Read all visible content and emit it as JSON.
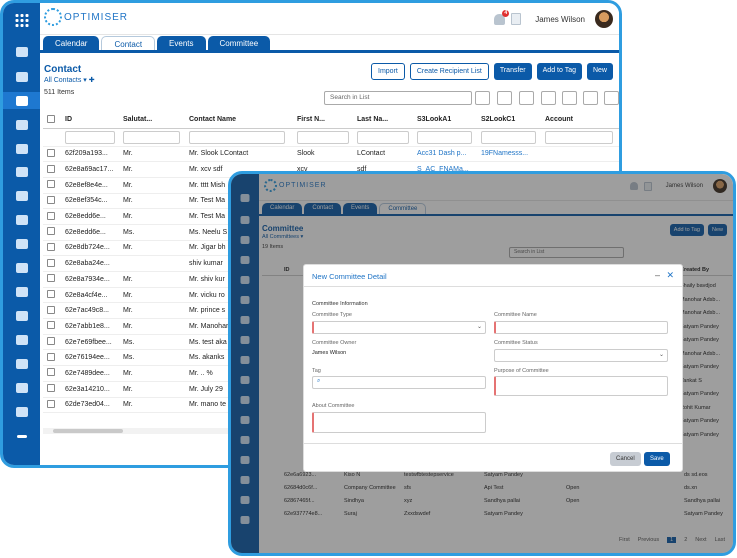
{
  "brand": "OPTIMISER",
  "user": {
    "name": "James Wilson",
    "notifications": "4"
  },
  "tabs": [
    "Calendar",
    "Contact",
    "Events",
    "Committee"
  ],
  "contact": {
    "title": "Contact",
    "view": "All Contacts",
    "count": "511 Items",
    "buttons": {
      "import": "Import",
      "create_list": "Create Recipient List",
      "transfer": "Transfer",
      "add_tag": "Add to Tag",
      "new": "New"
    },
    "search_placeholder": "Search in List",
    "columns": [
      "ID",
      "Salutat...",
      "Contact Name",
      "First N...",
      "Last Na...",
      "S3LookA1",
      "S2LookC1",
      "Account"
    ],
    "rows": [
      [
        "62f209a193...",
        "Mr.",
        "Mr. Slook LContact",
        "Slook",
        "LContact",
        "Acc31 Dash p...",
        "19FNamesss...",
        ""
      ],
      [
        "62e8a69ac17...",
        "Mr.",
        "Mr. xcv sdf",
        "xcv",
        "sdf",
        "S_AC_FNAMa...",
        "",
        ""
      ],
      [
        "62e8ef8e4e...",
        "Mr.",
        "Mr. tttt Mish",
        "",
        "",
        "",
        "",
        ""
      ],
      [
        "62e8ef354c...",
        "Mr.",
        "Mr. Test Ma",
        "",
        "",
        "",
        "",
        ""
      ],
      [
        "62e8edd6e...",
        "Mr.",
        "Mr. Test Ma",
        "",
        "",
        "",
        "",
        ""
      ],
      [
        "62e8edd6e...",
        "Ms.",
        "Ms. Neelu S",
        "",
        "",
        "",
        "",
        ""
      ],
      [
        "62e8db724e...",
        "Mr.",
        "Mr. Jigar bh",
        "",
        "",
        "",
        "",
        ""
      ],
      [
        "62e8aba24e...",
        "",
        "shiv kumar",
        "",
        "",
        "",
        "",
        ""
      ],
      [
        "62e8a7934e...",
        "Mr.",
        "Mr. shiv kur",
        "",
        "",
        "",
        "",
        ""
      ],
      [
        "62e8a4cf4e...",
        "Mr.",
        "Mr. vicku ro",
        "",
        "",
        "",
        "",
        ""
      ],
      [
        "62e7ac49c8...",
        "Mr.",
        "Mr. prince s",
        "",
        "",
        "",
        "",
        ""
      ],
      [
        "62e7abb1e8...",
        "Mr.",
        "Mr. Manohar",
        "",
        "",
        "",
        "",
        ""
      ],
      [
        "62e7e69fbee...",
        "Ms.",
        "Ms. test aka",
        "",
        "",
        "",
        "",
        ""
      ],
      [
        "62e76194ee...",
        "Ms.",
        "Ms. akanks",
        "",
        "",
        "",
        "",
        ""
      ],
      [
        "62e7489dee...",
        "Mr.",
        "Mr. .. %",
        "",
        "",
        "",
        "",
        ""
      ],
      [
        "62e3a14210...",
        "Mr.",
        "Mr. July 29",
        "",
        "",
        "",
        "",
        ""
      ],
      [
        "62de73ed04...",
        "Mr.",
        "Mr. mano te",
        "",
        "",
        "",
        "",
        ""
      ]
    ]
  },
  "committee": {
    "title": "Committee",
    "view": "All Committees",
    "count": "19 Items",
    "buttons": {
      "add_tag": "Add to Tag",
      "new": "New"
    },
    "search_placeholder": "Search in List",
    "columns": [
      "ID",
      "Created By"
    ],
    "right_col": [
      "Shaily bavdjod",
      "Manohar Adsb...",
      "Manohar Adsb...",
      "Satyam Pandey",
      "Satyam Pandey",
      "Manohar Adsb...",
      "Satyam Pandey",
      "Vankat S",
      "Satyam Pandey",
      "Rohit Kumar",
      "Satyam Pandey",
      "Satyam Pandey"
    ],
    "bottom_rows": [
      [
        "62e6a6923...",
        "Kiso N",
        "testwfbtestepservice",
        "Satyam Pandey",
        "",
        "ds sd.eos"
      ],
      [
        "62684d0c6f...",
        "Company Committee",
        "sfs",
        "Api Test",
        "Open",
        "ds.xn"
      ],
      [
        "62867465f...",
        "Sindhya",
        "xyz",
        "Sandhya pallai",
        "Open",
        "Sandhya pallai"
      ],
      [
        "62e937774e8...",
        "Suraj",
        "Zxxdswdef",
        "Satyam Pandey",
        "",
        "Satyam Pandey"
      ]
    ],
    "pagination": [
      "First",
      "Previous",
      "1",
      "2",
      "Next",
      "Last"
    ]
  },
  "modal": {
    "title": "New Committee Detail",
    "section": "Committee Information",
    "labels": {
      "type": "Committee Type",
      "name": "Committee Name",
      "owner": "Committee Owner",
      "status": "Committee Status",
      "tag": "Tag",
      "purpose": "Purpose of Committee",
      "about": "About Committee"
    },
    "owner_value": "James Wilson",
    "cancel": "Cancel",
    "save": "Save"
  }
}
